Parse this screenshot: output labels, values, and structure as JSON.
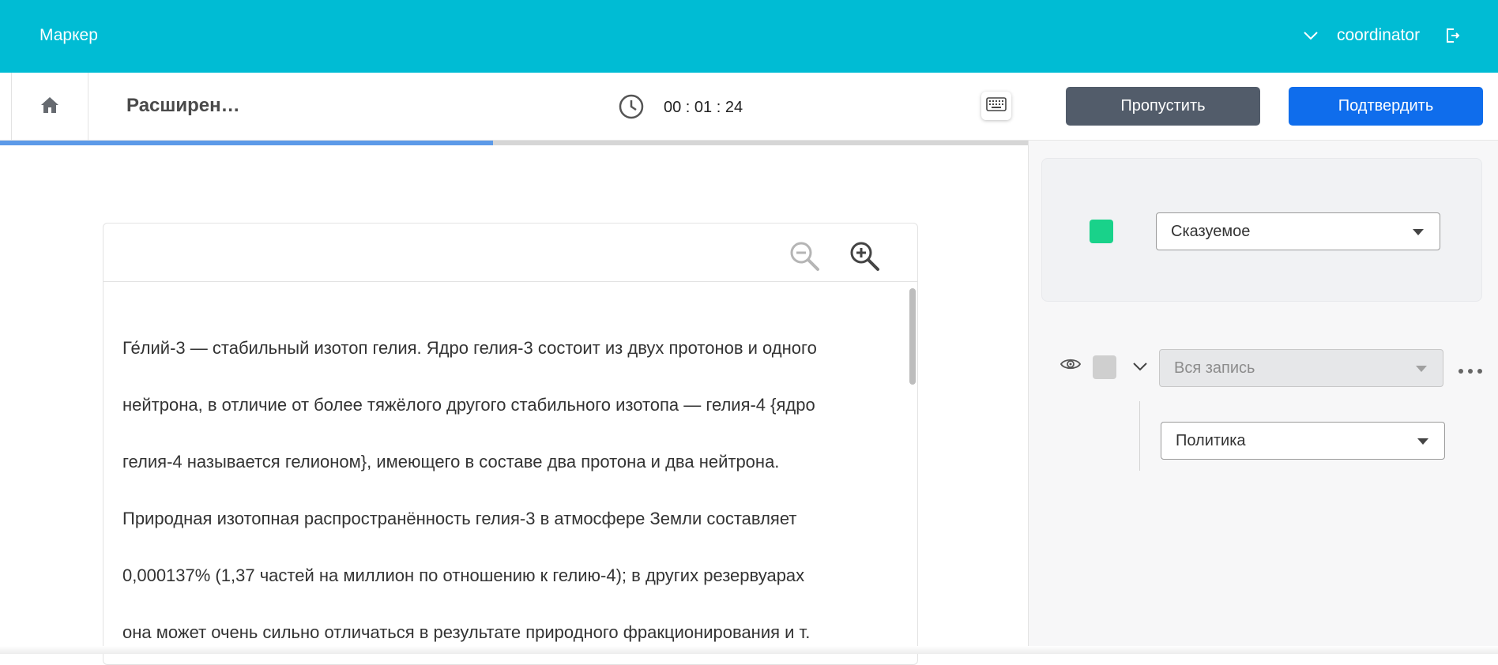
{
  "header": {
    "brand": "Маркер",
    "username": "coordinator",
    "icons": {
      "user_menu": "chevron-down-icon",
      "logout": "logout-icon"
    }
  },
  "toolbar": {
    "task_title": "Расширен…",
    "timer": "00 : 01 : 24",
    "skip_label": "Пропустить",
    "confirm_label": "Подтвердить",
    "icons": {
      "home": "home-icon",
      "timer": "clock-icon",
      "keyboard": "keyboard-icon"
    }
  },
  "progress": {
    "fraction": 0.48
  },
  "document": {
    "lines": [
      "Ге́лий-3 — стабильный изотоп гелия. Ядро гелия-3 состоит из двух протонов и одного",
      "нейтрона, в отличие от более тяжёлого другого стабильного изотопа — гелия-4 {ядро",
      "гелия-4 называется гелионом}, имеющего в составе два протона и два нейтрона.",
      "Природная изотопная распространённость гелия-3 в атмосфере Земли составляет",
      "0,000137% (1,37 частей на миллион по отношению к гелию-4); в других резервуарах",
      "она может очень сильно отличаться в результате природного фракционирования и т."
    ],
    "icons": {
      "zoom_out": "zoom-out-icon",
      "zoom_in": "zoom-in-icon"
    }
  },
  "labels_panel": {
    "active_label": {
      "value": "Сказуемое",
      "color": "#19d28a"
    },
    "record_row": {
      "value": "Вся запись",
      "color": "#cfcfcf",
      "disabled": true
    },
    "child_label": {
      "value": "Политика"
    }
  },
  "colors": {
    "header_bg": "#00bcd4",
    "skip_bg": "#525c6a",
    "confirm_bg": "#0f6dec",
    "progress": "#5c9ae8"
  }
}
